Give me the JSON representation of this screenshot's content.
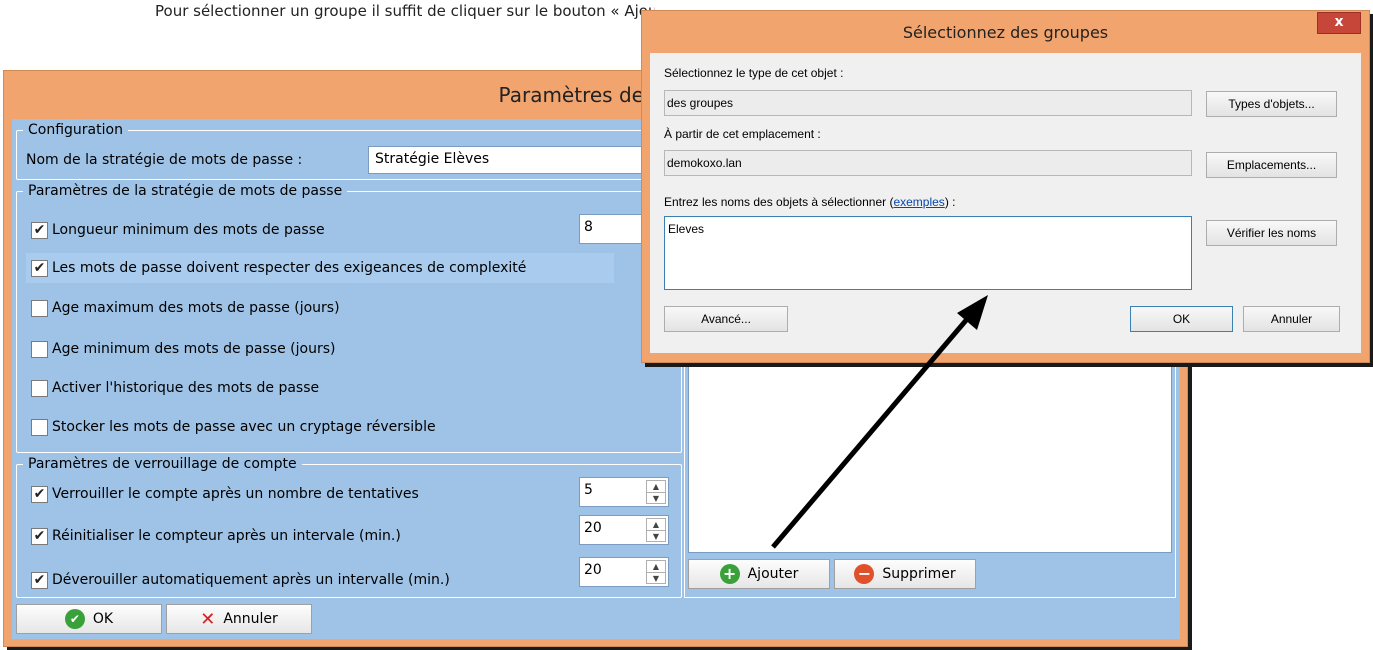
{
  "top_text": "Pour sélectionner un groupe il suffit de cliquer sur le bouton « Ajouter » et de sélectionner un groupe",
  "main_window": {
    "title": "Paramètres des mo",
    "configuration": {
      "legend": "Configuration",
      "name_label": "Nom de la stratégie de mots de passe :",
      "name_value": "Stratégie Elèves"
    },
    "password_policy": {
      "legend": "Paramètres de la stratégie de mots de passe",
      "items": [
        {
          "label": "Longueur minimum des mots de passe",
          "checked": true,
          "mark": "✔",
          "value": "8"
        },
        {
          "label": "Les mots de passe doivent respecter des exigeances de complexité",
          "checked": true,
          "mark": "✔"
        },
        {
          "label": "Age maximum des mots de passe (jours)",
          "checked": false,
          "mark": ""
        },
        {
          "label": "Age minimum des mots de passe (jours)",
          "checked": false,
          "mark": ""
        },
        {
          "label": "Activer l'historique des mots de passe",
          "checked": false,
          "mark": ""
        },
        {
          "label": "Stocker les mots de passe avec un cryptage réversible",
          "checked": false,
          "mark": ""
        }
      ]
    },
    "lockout": {
      "legend": "Paramètres de verrouillage de compte",
      "items": [
        {
          "label": "Verrouiller le compte après un nombre de tentatives",
          "checked": true,
          "mark": "✔",
          "value": "5"
        },
        {
          "label": "Réinitialiser le compteur après un intervale (min.)",
          "checked": true,
          "mark": "✔",
          "value": "20"
        },
        {
          "label": "Déverouiller automatiquement après un intervalle (min.)",
          "checked": true,
          "mark": "✔",
          "value": "20"
        }
      ]
    },
    "add_button": "Ajouter",
    "remove_button": "Supprimer",
    "ok_button": "OK",
    "cancel_button": "Annuler",
    "icons": {
      "ok": "✔",
      "cancel": "✕",
      "add": "+",
      "remove": "−",
      "spin_up": "▲",
      "spin_down": "▼"
    }
  },
  "dialog": {
    "title": "Sélectionnez des groupes",
    "close_glyph": "x",
    "object_type_label": "Sélectionnez le type de cet objet :",
    "object_type_value": "des groupes",
    "object_types_button": "Types d'objets...",
    "location_label": "À partir de cet emplacement :",
    "location_value": "demokoxo.lan",
    "locations_button": "Emplacements...",
    "names_label_prefix": "Entrez les noms des objets à sélectionner (",
    "names_label_link": "exemples",
    "names_label_suffix": ") :",
    "names_value": "Eleves",
    "check_names_button": "Vérifier les noms",
    "advanced_button": "Avancé...",
    "ok_button": "OK",
    "cancel_button": "Annuler"
  },
  "colors": {
    "window_frame": "#f1a46d",
    "panel_bg": "#9fc3e6",
    "close_button": "#c7463a",
    "ok_icon": "#3aa13a",
    "add_icon": "#3aa13a",
    "remove_icon": "#e0502a",
    "cancel_icon": "#d42020"
  }
}
